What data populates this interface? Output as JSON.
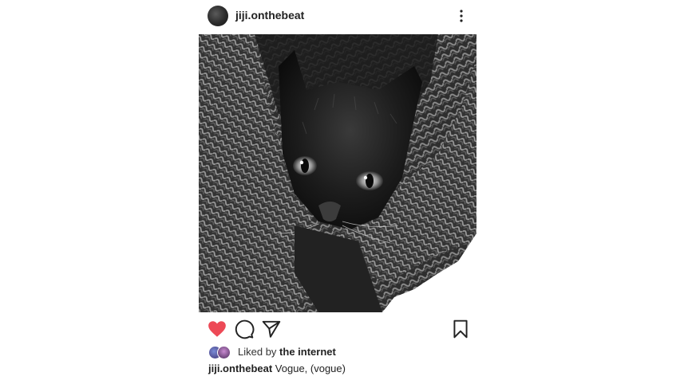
{
  "post": {
    "username": "jiji.onthebeat",
    "image_icon": "kitten-photo",
    "liked_prefix": "Liked by",
    "liked_by": "the internet",
    "caption_user": "jiji.onthebeat",
    "caption_text": "Vogue, (vogue)",
    "liked": true,
    "accent_like": "#ed4956"
  }
}
